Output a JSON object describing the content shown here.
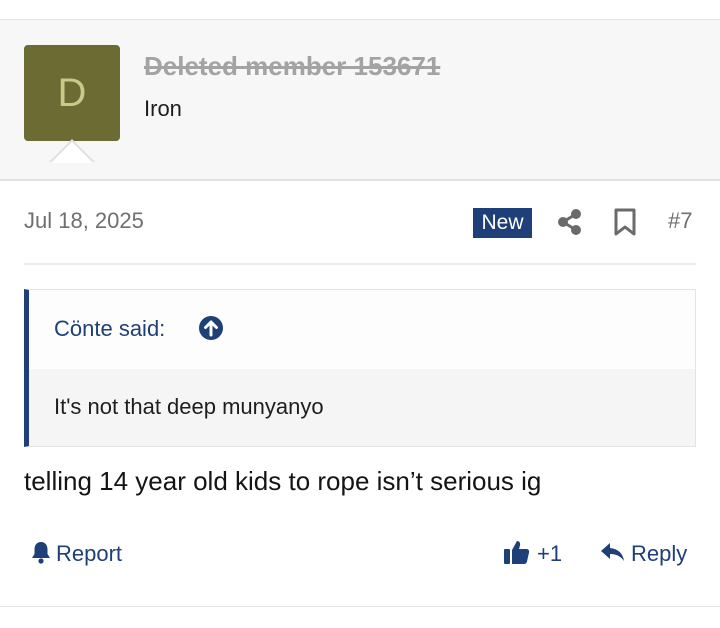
{
  "post": {
    "author": {
      "avatar_letter": "D",
      "avatar_color": "#6b6b33",
      "username": "Deleted member 153671",
      "user_title": "Iron"
    },
    "date": "Jul 18, 2025",
    "new_badge": "New",
    "post_number": "#7",
    "icons": {
      "share": "share-icon",
      "bookmark": "bookmark-icon",
      "quote_expand": "arrow-up-circle-icon",
      "report": "bell-icon",
      "like": "thumbs-up-icon",
      "reply": "reply-arrow-icon"
    },
    "quote": {
      "author_said": "Cönte said:",
      "text": "It's not that deep munyanyo"
    },
    "message": "telling 14 year old kids to rope isn’t serious ig",
    "actions": {
      "report": "Report",
      "like_count": "+1",
      "reply": "Reply"
    }
  },
  "colors": {
    "accent": "#1f3f78",
    "muted_text": "#6f6f6f",
    "header_bg": "#f7f7f7"
  }
}
